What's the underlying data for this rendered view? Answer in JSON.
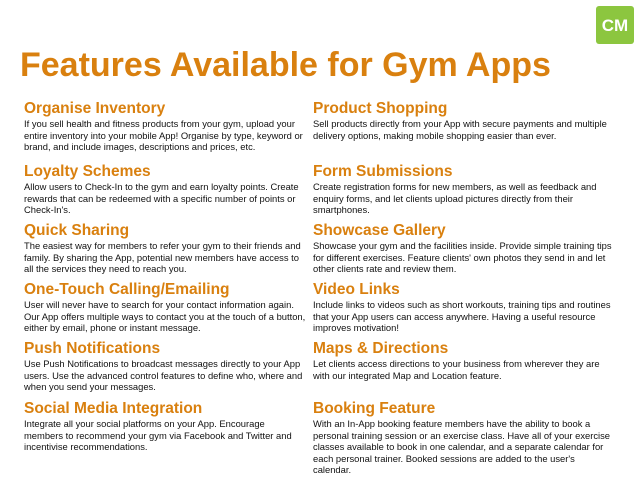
{
  "title": "Features Available for Gym Apps",
  "colors": {
    "accent": "#d9800f",
    "body_text": "#111111",
    "logo_green": "#8cc63f"
  },
  "logo": {
    "text": "CM",
    "icon": "cm-logo-icon"
  },
  "features_left": [
    {
      "heading": "Organise Inventory",
      "text": "If you sell health and fitness products from your gym, upload your entire inventory into your mobile App! Organise by type, keyword or brand, and include images, descriptions and prices, etc."
    },
    {
      "heading": "Loyalty Schemes",
      "text": "Allow users to Check-In to the gym and earn loyalty points. Create rewards that can be redeemed with a specific number of points or Check-In's."
    },
    {
      "heading": "Quick Sharing",
      "text": "The easiest way for members to refer your gym to their friends and family. By sharing the App, potential new members have access to all the services they need to reach you."
    },
    {
      "heading": "One-Touch Calling/Emailing",
      "text": "User will never have to search for your contact information again. Our App offers multiple ways to contact you at the touch of a button, either by email, phone or instant message."
    },
    {
      "heading": "Push Notifications",
      "text": "Use Push Notifications to broadcast messages directly to your App users. Use the advanced control features to define who, where and when you send your messages."
    },
    {
      "heading": "Social Media Integration",
      "text": "Integrate all your social platforms on your App. Encourage members to recommend your gym via Facebook and Twitter and incentivise recommendations."
    }
  ],
  "features_right": [
    {
      "heading": "Product Shopping",
      "text": "Sell products directly from your App with secure payments and multiple delivery options, making mobile shopping easier than ever."
    },
    {
      "heading": "Form Submissions",
      "text": "Create registration forms for new members, as well as feedback and enquiry forms, and let clients upload pictures directly from their smartphones."
    },
    {
      "heading": "Showcase Gallery",
      "text": "Showcase your gym and the facilities inside. Provide simple training tips for different exercises. Feature clients' own photos they send in and let other clients rate and review them."
    },
    {
      "heading": "Video Links",
      "text": "Include links to videos such as short workouts, training tips and routines that your App users can access anywhere. Having a useful resource improves motivation!"
    },
    {
      "heading": "Maps & Directions",
      "text": "Let clients access directions to your business from wherever they are with our integrated Map and Location feature."
    },
    {
      "heading": "Booking Feature",
      "text": "With an In-App booking feature members have the ability to book a personal training session or an exercise class. Have all of your exercise classes available to book in one calendar, and a separate calendar for each personal trainer. Booked sessions are added to the user's calendar."
    }
  ]
}
